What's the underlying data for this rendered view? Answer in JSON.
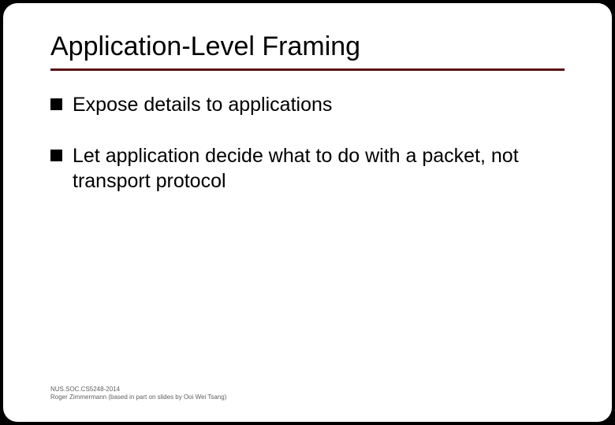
{
  "title": "Application-Level Framing",
  "bullets": [
    "Expose details to applications",
    "Let application decide what to do with a packet, not transport protocol"
  ],
  "footer": {
    "line1": "NUS.SOC.CS5248-2014",
    "line2": "Roger Zimmermann (based in part on slides by Ooi Wei Tsang)"
  }
}
